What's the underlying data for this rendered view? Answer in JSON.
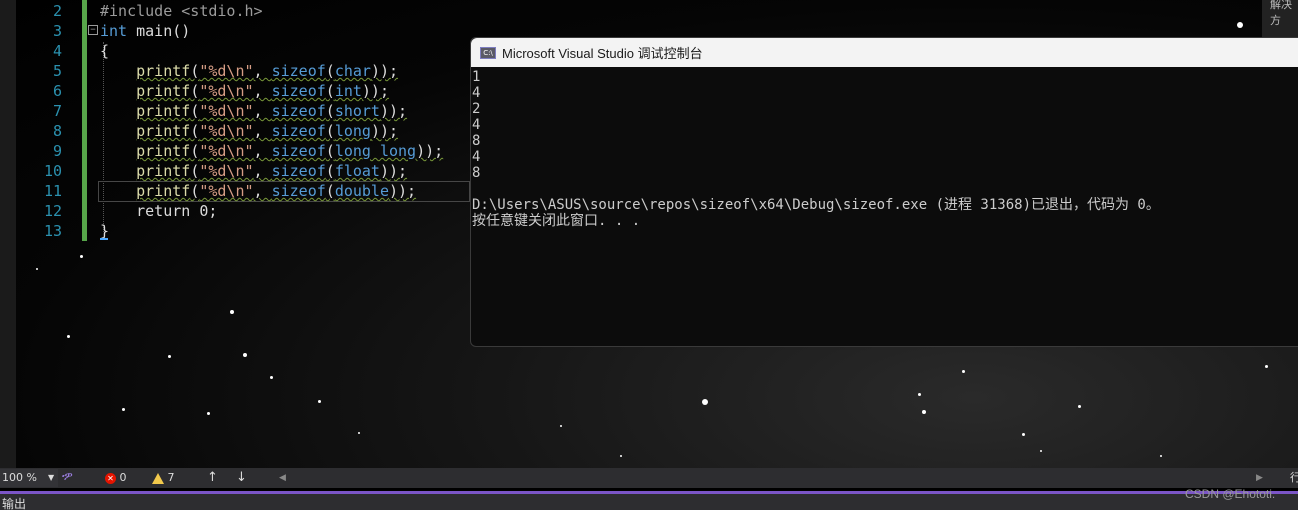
{
  "editor": {
    "line_numbers": [
      "2",
      "3",
      "4",
      "5",
      "6",
      "7",
      "8",
      "9",
      "10",
      "11",
      "12",
      "13"
    ],
    "code": {
      "l2": "#include <stdio.h>",
      "l3_kw": "int",
      "l3_rest": " main()",
      "l4": "{",
      "printf": "printf",
      "open": "(",
      "fmt": "\"%d\\n\"",
      "comma": ", ",
      "sizeof": "sizeof",
      "close": "));",
      "types": [
        "char",
        "int",
        "short",
        "long",
        "long long",
        "float",
        "double"
      ],
      "l12": "    return 0;",
      "l13": "}"
    }
  },
  "console": {
    "title": "Microsoft Visual Studio 调试控制台",
    "icon_text": "C:\\",
    "output": [
      "1",
      "4",
      "2",
      "4",
      "8",
      "4",
      "8",
      "",
      "D:\\Users\\ASUS\\source\\repos\\sizeof\\x64\\Debug\\sizeof.exe (进程 31368)已退出，代码为 0。",
      "按任意键关闭此窗口. . ."
    ]
  },
  "top_right": {
    "text": "解决方"
  },
  "status_bar": {
    "zoom": "100 %",
    "errors": "0",
    "warnings": "7",
    "up_arrow": "↑",
    "down_arrow": "↓",
    "left_arrow": "◀",
    "right_arrow": "▶",
    "right_label": "行"
  },
  "output_panel": {
    "label": "输出"
  },
  "watermark": "CSDN @Ehototi."
}
